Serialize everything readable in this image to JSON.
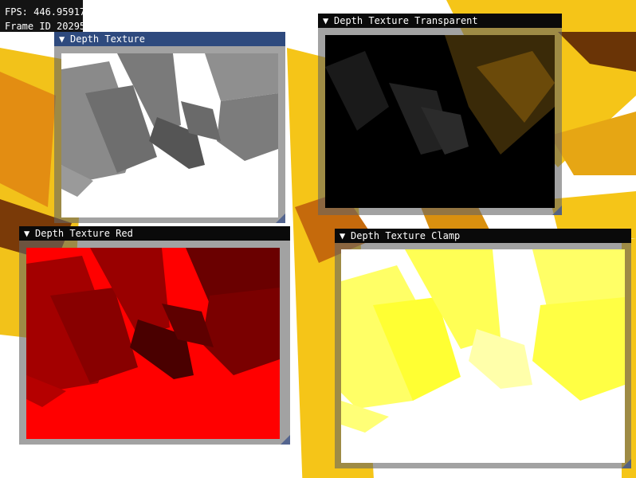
{
  "overlay": {
    "fps": "FPS: 446.95917",
    "frame": "Frame ID 20295"
  },
  "windows": {
    "depth_texture": {
      "title": "Depth Texture",
      "active": true
    },
    "depth_texture_transparent": {
      "title": "Depth Texture Transparent"
    },
    "depth_texture_red": {
      "title": "Depth Texture Red"
    },
    "depth_texture_clamp": {
      "title": "Depth Texture Clamp"
    }
  },
  "icons": {
    "collapse": "collapse-triangle-icon"
  },
  "colors": {
    "title_inactive": "#0a0a0a",
    "title_active": "#2e4a7e",
    "window_border": "#666666",
    "scene_yellow": "#f5c518",
    "scene_orange": "#e08a10",
    "depth_red": "#ff0000",
    "depth_clamp_yellow": "#ffff55"
  }
}
